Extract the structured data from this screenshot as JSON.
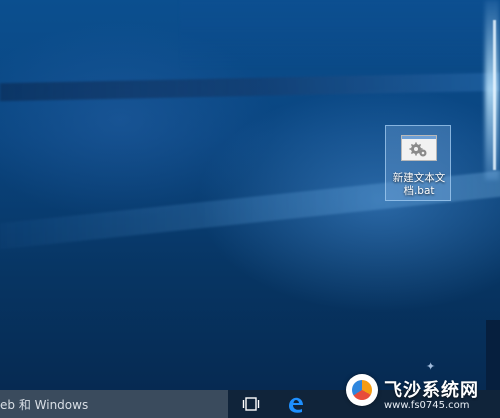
{
  "desktop": {
    "top_text": "  ",
    "icon": {
      "label": "新建文本文档.bat",
      "icon_name": "settings-file-icon"
    }
  },
  "taskbar": {
    "search_text": "eb 和 Windows",
    "task_view_icon": "task-view-icon",
    "edge_icon": "edge-icon",
    "background": "#10243a",
    "search_background": "#3a4b5d"
  },
  "watermark": {
    "title": "飞沙系统网",
    "url": "www.fs0745.com"
  }
}
